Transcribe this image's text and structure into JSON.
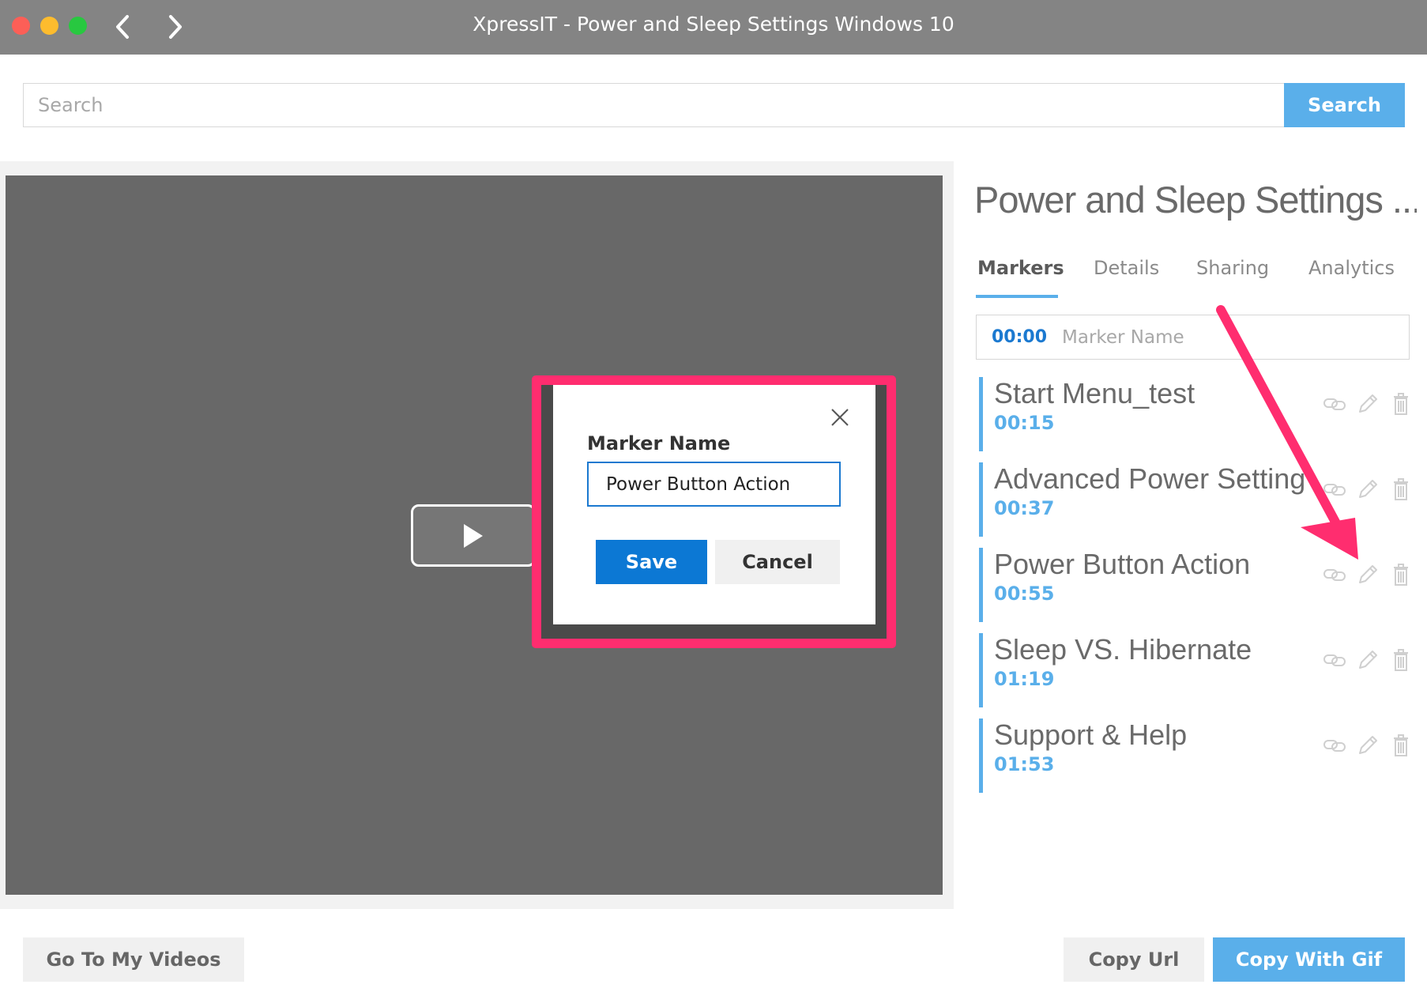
{
  "window": {
    "title": "XpressIT - Power and Sleep Settings Windows 10"
  },
  "search": {
    "placeholder": "Search",
    "button_label": "Search"
  },
  "modal": {
    "label": "Marker Name",
    "input_value": "Power Button Action",
    "save_label": "Save",
    "cancel_label": "Cancel"
  },
  "panel": {
    "title": "Power and Sleep Settings ...",
    "tabs": [
      {
        "label": "Markers",
        "active": true
      },
      {
        "label": "Details",
        "active": false
      },
      {
        "label": "Sharing",
        "active": false
      },
      {
        "label": "Analytics",
        "active": false
      }
    ],
    "new_marker": {
      "time": "00:00",
      "placeholder": "Marker Name"
    },
    "markers": [
      {
        "name": "Start Menu_test",
        "time": "00:15"
      },
      {
        "name": "Advanced Power Setting",
        "time": "00:37"
      },
      {
        "name": "Power Button Action",
        "time": "00:55"
      },
      {
        "name": "Sleep VS. Hibernate",
        "time": "01:19"
      },
      {
        "name": "Support & Help",
        "time": "01:53"
      }
    ]
  },
  "footer": {
    "my_videos_label": "Go To My Videos",
    "copy_url_label": "Copy Url",
    "copy_gif_label": "Copy With Gif"
  },
  "colors": {
    "accent": "#5aafea",
    "primary_button": "#0c78d4",
    "highlight": "#ff2d6f",
    "titlebar": "#848484",
    "video_bg": "#686868"
  },
  "icons": {
    "marker_actions": [
      "link-icon",
      "pencil-icon",
      "trash-icon"
    ],
    "modal_close": "close-icon",
    "play": "play-icon"
  }
}
